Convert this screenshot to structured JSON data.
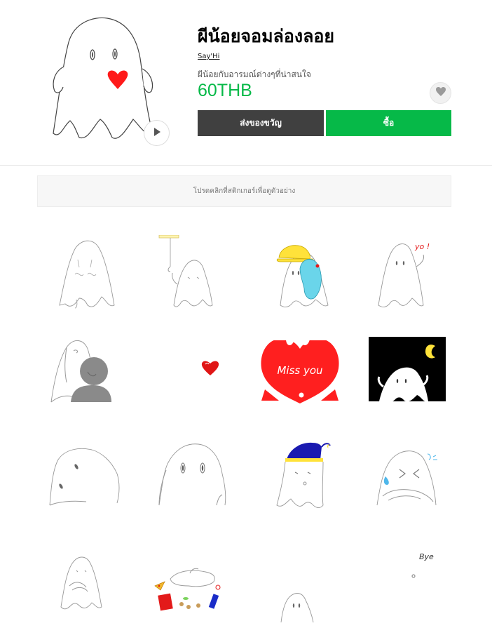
{
  "product": {
    "title": "ผีน้อยจอมล่องลอย",
    "author": "Say'Hi",
    "description": "ผีน้อยกับอารมณ์ต่างๆที่น่าสนใจ",
    "price": "60THB",
    "main_image": "ghost-with-heart",
    "icons": {
      "play": "play-icon",
      "favorite": "heart-icon"
    }
  },
  "buttons": {
    "gift_label": "ส่งของขวัญ",
    "buy_label": "ซื้อ"
  },
  "preview": {
    "hint": "โปรดคลิกที่สติกเกอร์เพื่อดูตัวอย่าง"
  },
  "stickers": [
    {
      "name": "ghost-crying",
      "text": ""
    },
    {
      "name": "ghost-hanging-lamp",
      "text": ""
    },
    {
      "name": "ghost-with-cap-character",
      "text": ""
    },
    {
      "name": "ghost-yo-wave",
      "text": "yo !"
    },
    {
      "name": "ghost-hug-gray-person",
      "text": ""
    },
    {
      "name": "small-red-heart",
      "text": ""
    },
    {
      "name": "miss-you-heart",
      "text": "Miss you"
    },
    {
      "name": "ghost-night-moon",
      "text": ""
    },
    {
      "name": "ghost-peeking",
      "text": ""
    },
    {
      "name": "ghost-closeup",
      "text": ""
    },
    {
      "name": "ghost-sleep-cap",
      "text": ""
    },
    {
      "name": "ghost-arms-crossed-sweat",
      "text": ""
    },
    {
      "name": "ghost-arms-folded",
      "text": ""
    },
    {
      "name": "ghost-lying-snacks",
      "text": ""
    },
    {
      "name": "ghost-small-bottom",
      "text": ""
    },
    {
      "name": "ghost-bye",
      "text": "Bye"
    }
  ],
  "colors": {
    "accent_green": "#06b948",
    "gift_button": "#404040",
    "heart_red": "#ff1a1a"
  }
}
